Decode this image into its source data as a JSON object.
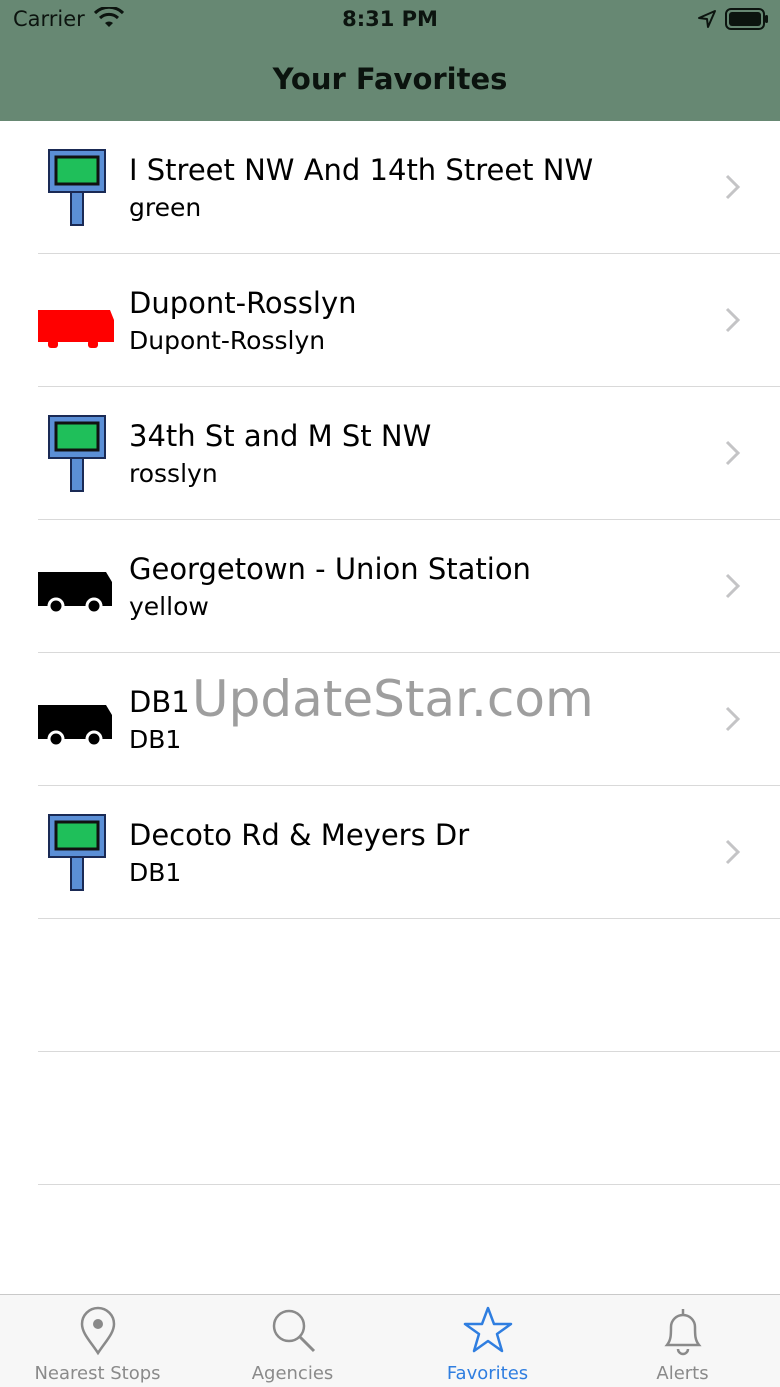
{
  "status_bar": {
    "carrier": "Carrier",
    "time": "8:31 PM"
  },
  "nav": {
    "title": "Your Favorites"
  },
  "favorites": [
    {
      "title": "I Street NW And 14th Street NW",
      "subtitle": "green",
      "icon": "stop-sign-icon"
    },
    {
      "title": "Dupont-Rosslyn",
      "subtitle": "Dupont-Rosslyn",
      "icon": "bus-icon",
      "icon_color": "#ff0000"
    },
    {
      "title": "34th St and M St NW",
      "subtitle": "rosslyn",
      "icon": "stop-sign-icon"
    },
    {
      "title": "Georgetown - Union Station",
      "subtitle": "yellow",
      "icon": "bus-icon",
      "icon_color": "#000000"
    },
    {
      "title": "DB1",
      "subtitle": "DB1",
      "icon": "bus-icon",
      "icon_color": "#000000"
    },
    {
      "title": "Decoto Rd & Meyers Dr",
      "subtitle": "DB1",
      "icon": "stop-sign-icon"
    }
  ],
  "watermark": "UpdateStar.com",
  "tabs": [
    {
      "label": "Nearest Stops",
      "icon": "map-pin-icon",
      "active": false
    },
    {
      "label": "Agencies",
      "icon": "search-icon",
      "active": false
    },
    {
      "label": "Favorites",
      "icon": "star-icon",
      "active": true
    },
    {
      "label": "Alerts",
      "icon": "bell-icon",
      "active": false
    }
  ],
  "colors": {
    "header": "#678873",
    "accent": "#2f7ee0",
    "stop_sign_green": "#1fbf5a",
    "stop_pole": "#5b8fd6"
  }
}
